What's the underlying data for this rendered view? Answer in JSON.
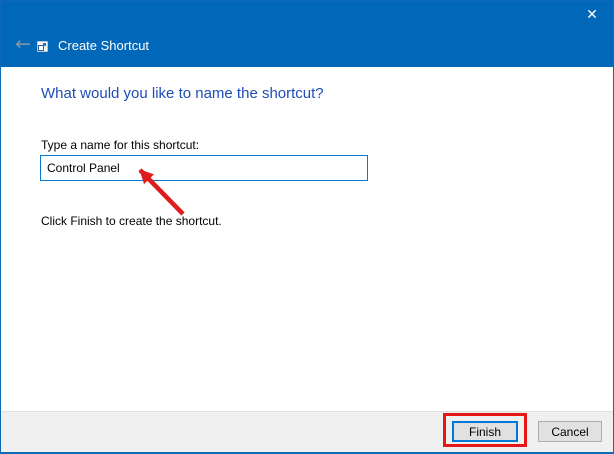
{
  "window": {
    "title": "Create Shortcut"
  },
  "icons": {
    "back": "←",
    "close": "✕",
    "app_icon_name": "shortcut-file-icon"
  },
  "main": {
    "heading": "What would you like to name the shortcut?",
    "input_label": "Type a name for this shortcut:",
    "input_value": "Control Panel",
    "instruction": "Click Finish to create the shortcut."
  },
  "footer": {
    "finish_label": "Finish",
    "cancel_label": "Cancel"
  },
  "colors": {
    "header_blue": "#0167B8",
    "heading_text_blue": "#1E4DB7",
    "focus_border_blue": "#0078D7",
    "footer_gray": "#F0F0F0",
    "button_gray": "#E1E1E1",
    "button_border_gray": "#ADADAD",
    "annotation_red": "#E51717"
  },
  "annotations": {
    "arrow": "red arrow pointing at shortcut name input",
    "box": "red box highlighting Finish button"
  }
}
